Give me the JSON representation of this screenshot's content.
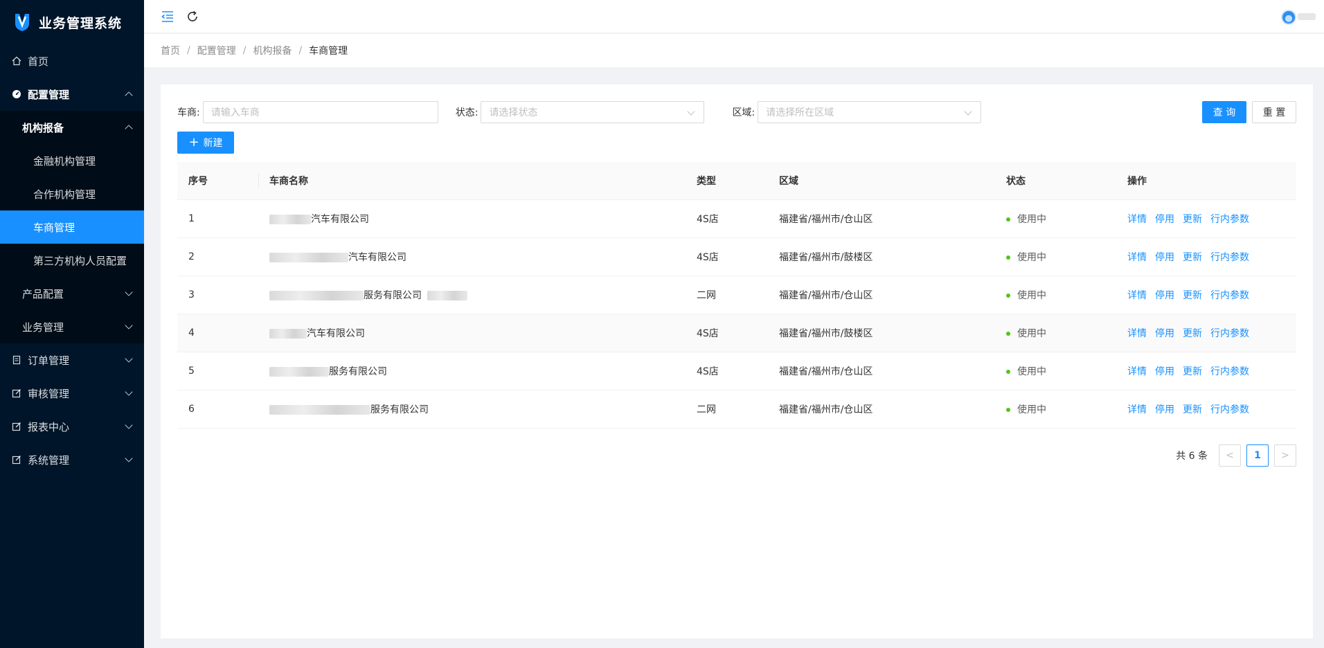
{
  "app": {
    "title": "业务管理系统"
  },
  "sidebar": {
    "home": "首页",
    "config": "配置管理",
    "agency": "机构报备",
    "agency_items": [
      "金融机构管理",
      "合作机构管理",
      "车商管理",
      "第三方机构人员配置"
    ],
    "product": "产品配置",
    "business": "业务管理",
    "order": "订单管理",
    "audit": "审核管理",
    "report": "报表中心",
    "system": "系统管理"
  },
  "breadcrumb": [
    "首页",
    "配置管理",
    "机构报备",
    "车商管理"
  ],
  "filters": {
    "dealer_label": "车商:",
    "dealer_placeholder": "请输入车商",
    "status_label": "状态:",
    "status_placeholder": "请选择状态",
    "region_label": "区域:",
    "region_placeholder": "请选择所在区域",
    "query": "查 询",
    "reset": "重 置"
  },
  "new_button": "新建",
  "table": {
    "columns": [
      "序号",
      "车商名称",
      "类型",
      "区域",
      "状态",
      "操作"
    ],
    "rows": [
      {
        "index": "1",
        "name_suffix": "汽车有限公司",
        "type": "4S店",
        "region": "福建省/福州市/仓山区",
        "status": "使用中"
      },
      {
        "index": "2",
        "name_suffix": "汽车有限公司",
        "type": "4S店",
        "region": "福建省/福州市/鼓楼区",
        "status": "使用中"
      },
      {
        "index": "3",
        "name_suffix": "服务有限公司",
        "type": "二网",
        "region": "福建省/福州市/仓山区",
        "status": "使用中"
      },
      {
        "index": "4",
        "name_suffix": "汽车有限公司",
        "type": "4S店",
        "region": "福建省/福州市/鼓楼区",
        "status": "使用中"
      },
      {
        "index": "5",
        "name_suffix": "服务有限公司",
        "type": "4S店",
        "region": "福建省/福州市/仓山区",
        "status": "使用中"
      },
      {
        "index": "6",
        "name_suffix": "服务有限公司",
        "type": "二网",
        "region": "福建省/福州市/仓山区",
        "status": "使用中"
      }
    ],
    "actions": [
      "详情",
      "停用",
      "更新",
      "行内参数"
    ]
  },
  "pagination": {
    "total": "共 6 条",
    "current": "1",
    "prev": "<",
    "next": ">"
  },
  "colors": {
    "primary": "#1890ff",
    "sidebar": "#001529",
    "success": "#52c41a"
  },
  "icons": [
    "collapse-menu-icon",
    "refresh-icon",
    "home-icon",
    "dashboard-icon",
    "order-icon",
    "edit-icon"
  ]
}
